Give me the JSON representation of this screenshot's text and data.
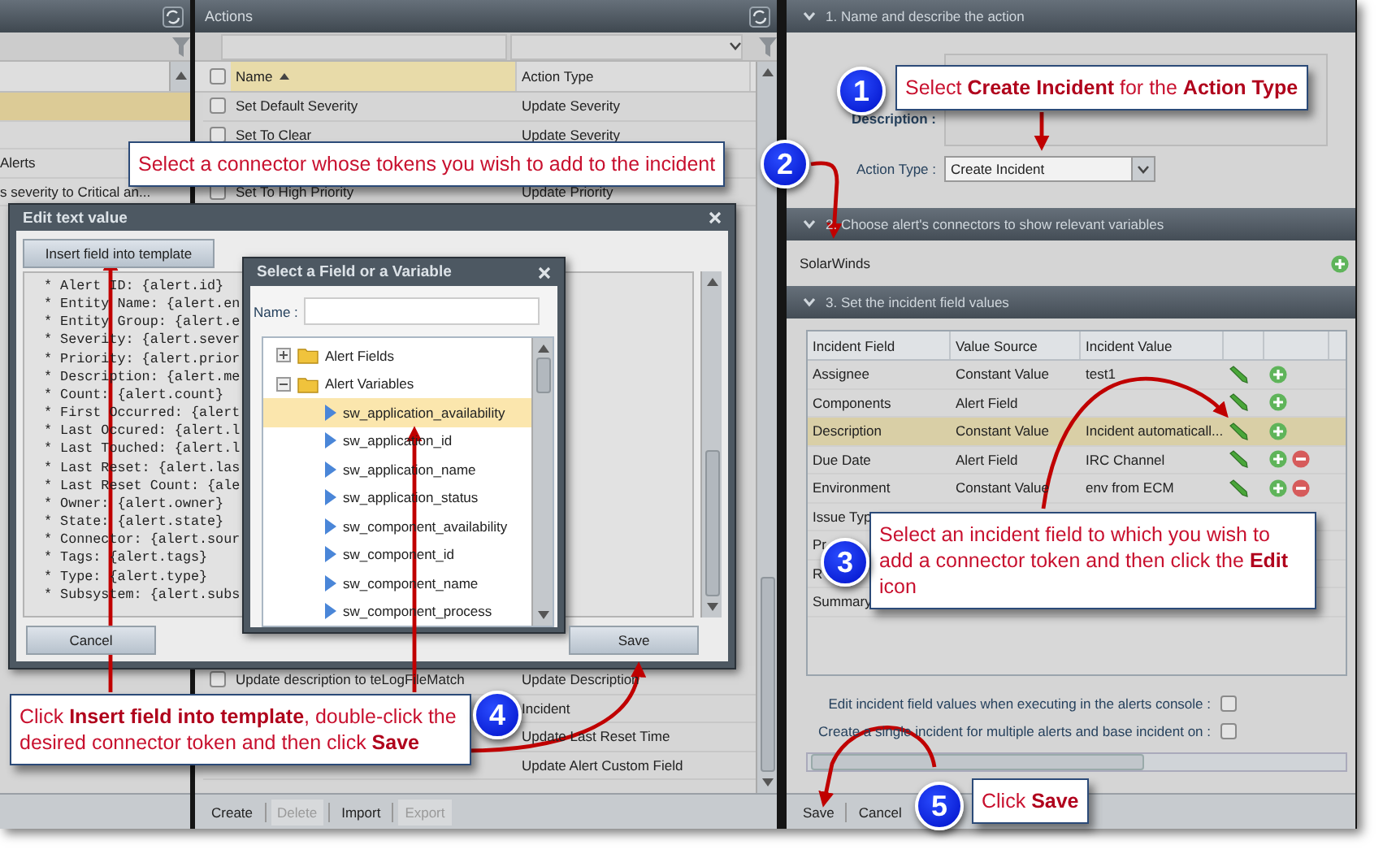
{
  "left_panel": {
    "rows": [
      {
        "selected": true
      },
      {
        "selected": false
      },
      {
        "text": "Alerts",
        "selected": false
      },
      {
        "text": "s severity to Critical an...",
        "selected": false
      }
    ]
  },
  "actions_panel": {
    "title": "Actions",
    "select_all": {
      "checked": false
    },
    "columns": [
      {
        "label": "Name",
        "sorted": true
      },
      {
        "label": "Action Type",
        "sorted": false
      }
    ],
    "rows": [
      {
        "name": "Set Default Severity",
        "action_type": "Update Severity",
        "checked": false
      },
      {
        "name": "Set To Clear",
        "action_type": "Update Severity",
        "checked": false
      },
      {},
      {
        "name": "Set To High Priority",
        "action_type": "Update Priority",
        "checked": false
      }
    ],
    "lower_rows": [
      {
        "name": "Update description to teLogFileMatch",
        "action_type": "Update Description",
        "checked": false
      },
      {
        "action_type": "Incident"
      },
      {
        "action_type": "Update Last Reset Time"
      },
      {
        "action_type": "Update Alert Custom Field"
      }
    ],
    "footer": [
      {
        "label": "Create",
        "disabled": false
      },
      {
        "label": "Delete",
        "disabled": true
      },
      {
        "label": "Import",
        "disabled": false
      },
      {
        "label": "Export",
        "disabled": true
      }
    ]
  },
  "edit_dialog": {
    "title": "Edit text value",
    "insert_button": "Insert field into template",
    "lines": [
      "* Alert ID: {alert.id}",
      "* Entity Name: {alert.en",
      "* Entity Group: {alert.e",
      "* Severity: {alert.sever",
      "* Priority: {alert.prior",
      "* Description: {alert.me",
      "* Count: {alert.count}",
      "* First Occurred: {alert",
      "* Last Occured: {alert.l",
      "* Last Touched: {alert.l",
      "* Last Reset: {alert.las",
      "* Last Reset Count: {ale",
      "* Owner: {alert.owner}",
      "* State: {alert.state}",
      "* Connector: {alert.sour",
      "* Tags: {alert.tags}",
      "* Type: {alert.type}",
      "* Subsystem: {alert.subs"
    ],
    "cancel_button": "Cancel",
    "save_button": "Save"
  },
  "select_dialog": {
    "title": "Select a Field or a Variable",
    "name_label": "Name :",
    "tree": [
      {
        "label": "Alert Fields",
        "expanded": false
      },
      {
        "label": "Alert Variables",
        "expanded": true,
        "children": [
          {
            "label": "sw_application_availability",
            "selected": true
          },
          {
            "label": "sw_application_id",
            "selected": false
          },
          {
            "label": "sw_application_name",
            "selected": false
          },
          {
            "label": "sw_application_status",
            "selected": false
          },
          {
            "label": "sw_component_availability",
            "selected": false
          },
          {
            "label": "sw_component_id",
            "selected": false
          },
          {
            "label": "sw_component_name",
            "selected": false
          },
          {
            "label": "sw_component_process",
            "selected": false
          }
        ]
      }
    ]
  },
  "right_panel": {
    "name_section": {
      "title": "1. Name and describe the action",
      "expanded": true,
      "description_label": "Description :",
      "action_type_label": "Action Type :",
      "action_type_value": "Create Incident"
    },
    "connectors_section": {
      "title": "2. Choose alert's connectors to show relevant variables",
      "expanded": true,
      "connectors": [
        "SolarWinds"
      ]
    },
    "fields_section": {
      "title": "3. Set the incident field values",
      "expanded": true,
      "columns": [
        "Incident Field",
        "Value Source",
        "Incident Value"
      ],
      "rows": [
        {
          "field": "Assignee",
          "source": "Constant Value",
          "value": "test1",
          "removable": false,
          "selected": false
        },
        {
          "field": "Components",
          "source": "Alert Field",
          "removable": false,
          "selected": false
        },
        {
          "field": "Description",
          "source": "Constant Value",
          "value": "Incident automaticall...",
          "removable": false,
          "selected": true
        },
        {
          "field": "Due Date",
          "source": "Alert Field",
          "value": "IRC Channel",
          "removable": true,
          "selected": false
        },
        {
          "field": "Environment",
          "source": "Constant Value",
          "value": "env from ECM",
          "removable": true,
          "selected": false
        },
        {
          "field": "Issue Typ",
          "selected": false
        },
        {
          "field": "Pr",
          "selected": false
        },
        {
          "field": "R",
          "selected": false
        },
        {
          "field": "Summary",
          "selected": false
        }
      ],
      "options": [
        {
          "label": "Edit incident field values when executing in the alerts console :",
          "checked": false
        },
        {
          "label": "Create a single incident for multiple alerts and base incident on  :",
          "checked": false
        }
      ]
    },
    "footer": [
      "Save",
      "Cancel"
    ]
  },
  "callouts": [
    {
      "number": "1",
      "text": "Select **Create Incident** for the **Action Type**"
    },
    {
      "number": "2",
      "text": "Select a connector whose tokens you wish to add to the incident"
    },
    {
      "number": "3",
      "text": "Select an incident field to which you wish to add a connector token and then click the **Edit** icon"
    },
    {
      "number": "4",
      "text": "Click **Insert field into template**, double-click the desired connector token and then click **Save**"
    },
    {
      "number": "5",
      "text": "Click **Save**"
    }
  ]
}
